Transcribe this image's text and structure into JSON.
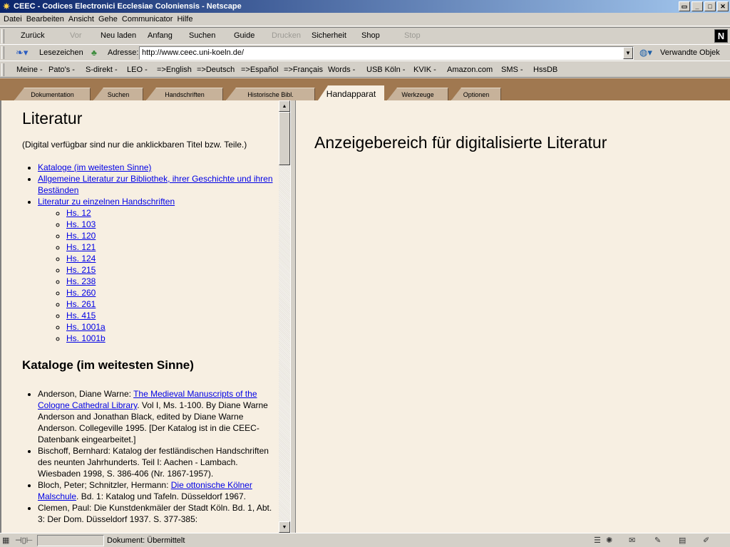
{
  "window": {
    "title": "CEEC - Codices Electronici Ecclesiae Coloniensis - Netscape"
  },
  "menu": [
    "Datei",
    "Bearbeiten",
    "Ansicht",
    "Gehe",
    "Communicator",
    "Hilfe"
  ],
  "nav": {
    "back": "Zurück",
    "forward": "Vor",
    "reload": "Neu laden",
    "home": "Anfang",
    "search": "Suchen",
    "guide": "Guide",
    "print": "Drucken",
    "security": "Sicherheit",
    "shop": "Shop",
    "stop": "Stop"
  },
  "location": {
    "bookmarks": "Lesezeichen",
    "address_label": "Adresse:",
    "url": "http://www.ceec.uni-koeln.de/",
    "related": "Verwandte Objek"
  },
  "personal": [
    "Meine -",
    "Pato's -",
    "S-direkt -",
    "LEO -",
    "=>English",
    "=>Deutsch",
    "=>Español",
    "=>Français",
    "Words -",
    "USB Köln -",
    "KVIK -",
    "Amazon.com",
    "SMS -",
    "HssDB"
  ],
  "tabs": [
    "Dokumentation",
    "Suchen",
    "Handschriften",
    "Historische Bibl.",
    "Handapparat",
    "Werkzeuge",
    "Optionen"
  ],
  "left": {
    "title": "Literatur",
    "note": "(Digital verfügbar sind nur die anklickbaren Titel bzw. Teile.)",
    "toc": [
      "Kataloge (im weitesten Sinne)",
      "Allgemeine Literatur zur Bibliothek, ihrer Geschichte und ihren Beständen",
      "Literatur zu einzelnen Handschriften"
    ],
    "hs": [
      "Hs. 12",
      "Hs. 103",
      "Hs. 120",
      "Hs. 121",
      "Hs. 124",
      "Hs. 215",
      "Hs. 238",
      "Hs. 260",
      "Hs. 261",
      "Hs. 415",
      "Hs. 1001a",
      "Hs. 1001b"
    ],
    "section_title": "Kataloge (im weitesten Sinne)",
    "refs": [
      {
        "pre": "Anderson, Diane Warne: ",
        "link": "The Medieval Manuscripts of the Cologne Cathedral Library",
        "post": ". Vol I, Ms. 1-100. By Diane Warne Anderson and Jonathan Black, edited by Diane Warne Anderson. Collegeville 1995. [Der Katalog ist in die CEEC-Datenbank eingearbeitet.]"
      },
      {
        "pre": "Bischoff, Bernhard: Katalog der festländischen Handschriften des neunten Jahrhunderts. Teil I: Aachen - Lambach. Wiesbaden 1998, S. 386-406 (Nr. 1867-1957).",
        "link": "",
        "post": ""
      },
      {
        "pre": "Bloch, Peter; Schnitzler, Hermann: ",
        "link": "Die ottonische Kölner Malschule",
        "post": ". Bd. 1: Katalog und Tafeln. Düsseldorf 1967."
      },
      {
        "pre": "Clemen, Paul: Die Kunstdenkmäler der Stadt Köln. Bd. 1, Abt. 3: Der Dom. Düsseldorf 1937. S. 377-385:",
        "link": "",
        "post": ""
      }
    ]
  },
  "right": {
    "title": "Anzeigebereich für digitalisierte Literatur"
  },
  "status": {
    "text": "Dokument: Übermittelt"
  }
}
